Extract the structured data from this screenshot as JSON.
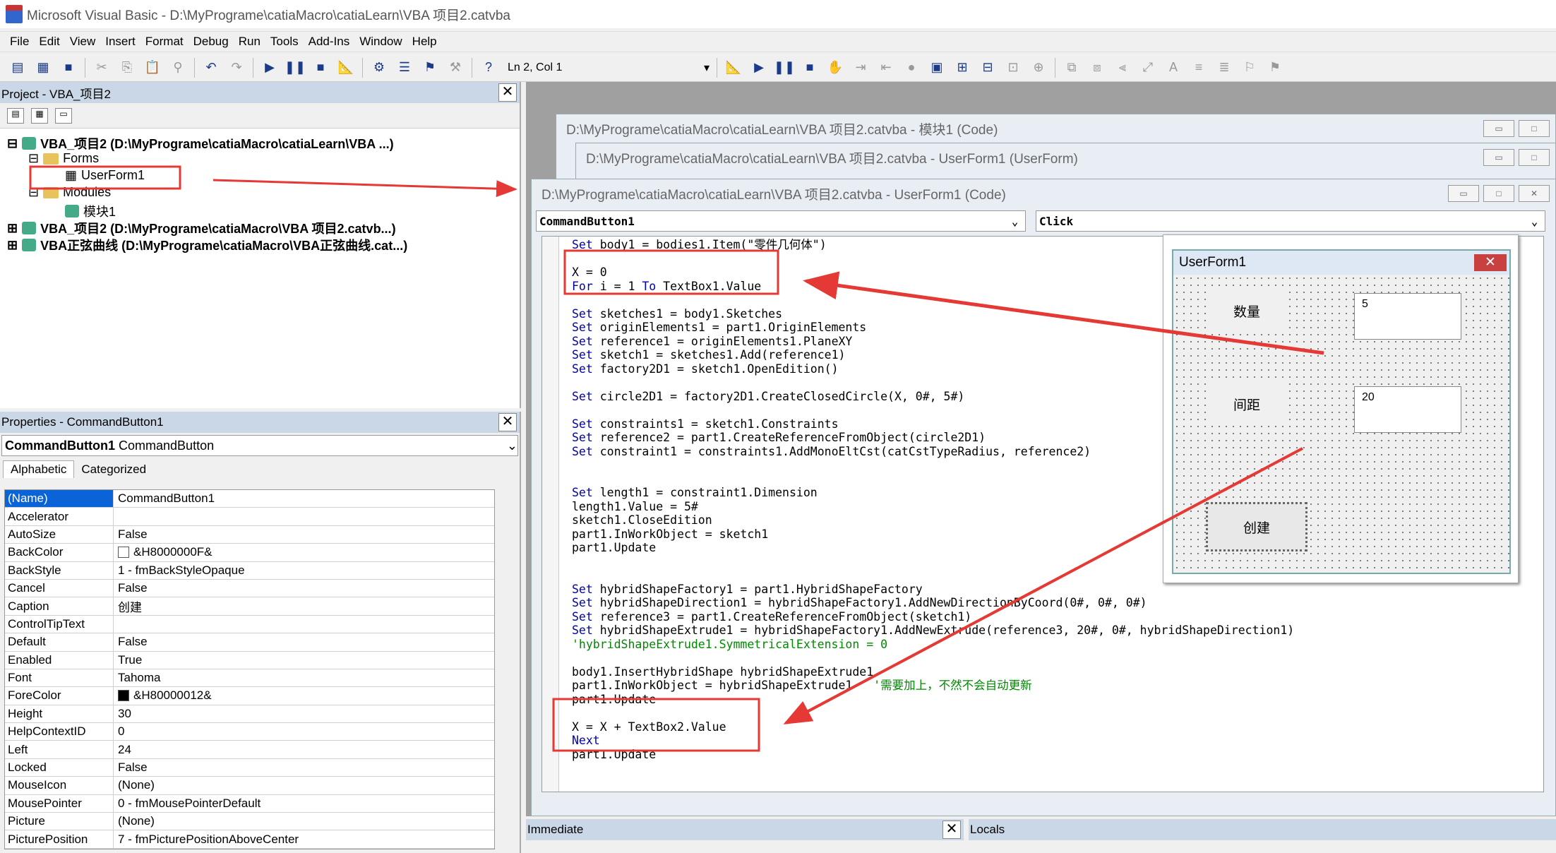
{
  "window": {
    "title": "Microsoft Visual Basic - D:\\MyPrograme\\catiaMacro\\catiaLearn\\VBA 项目2.catvba"
  },
  "menu": [
    "File",
    "Edit",
    "View",
    "Insert",
    "Format",
    "Debug",
    "Run",
    "Tools",
    "Add-Ins",
    "Window",
    "Help"
  ],
  "toolbar": {
    "position": "Ln 2, Col 1"
  },
  "project": {
    "title": "Project - VBA_项目2",
    "tree": [
      {
        "label": "VBA_项目2 (D:\\MyPrograme\\catiaMacro\\catiaLearn\\VBA ...)"
      },
      {
        "label": "Forms"
      },
      {
        "label": "UserForm1"
      },
      {
        "label": "Modules"
      },
      {
        "label": "模块1"
      },
      {
        "label": "VBA_项目2 (D:\\MyPrograme\\catiaMacro\\VBA 项目2.catvb...)"
      },
      {
        "label": "VBA正弦曲线 (D:\\MyPrograme\\catiaMacro\\VBA正弦曲线.cat...)"
      }
    ]
  },
  "properties": {
    "title": "Properties - CommandButton1",
    "object_name": "CommandButton1",
    "object_type": "CommandButton",
    "tabs": [
      "Alphabetic",
      "Categorized"
    ],
    "rows": [
      {
        "k": "(Name)",
        "v": "CommandButton1"
      },
      {
        "k": "Accelerator",
        "v": ""
      },
      {
        "k": "AutoSize",
        "v": "False"
      },
      {
        "k": "BackColor",
        "v": "&H8000000F&",
        "swatch": "#ffffff"
      },
      {
        "k": "BackStyle",
        "v": "1 - fmBackStyleOpaque"
      },
      {
        "k": "Cancel",
        "v": "False"
      },
      {
        "k": "Caption",
        "v": "创建"
      },
      {
        "k": "ControlTipText",
        "v": ""
      },
      {
        "k": "Default",
        "v": "False"
      },
      {
        "k": "Enabled",
        "v": "True"
      },
      {
        "k": "Font",
        "v": "Tahoma"
      },
      {
        "k": "ForeColor",
        "v": "&H80000012&",
        "swatch": "#000000"
      },
      {
        "k": "Height",
        "v": "30"
      },
      {
        "k": "HelpContextID",
        "v": "0"
      },
      {
        "k": "Left",
        "v": "24"
      },
      {
        "k": "Locked",
        "v": "False"
      },
      {
        "k": "MouseIcon",
        "v": "(None)"
      },
      {
        "k": "MousePointer",
        "v": "0 - fmMousePointerDefault"
      },
      {
        "k": "Picture",
        "v": "(None)"
      },
      {
        "k": "PicturePosition",
        "v": "7 - fmPicturePositionAboveCenter"
      }
    ]
  },
  "windows": {
    "module": "D:\\MyPrograme\\catiaMacro\\catiaLearn\\VBA 项目2.catvba - 模块1 (Code)",
    "form_designer": "D:\\MyPrograme\\catiaMacro\\catiaLearn\\VBA 项目2.catvba - UserForm1 (UserForm)",
    "code": "D:\\MyPrograme\\catiaMacro\\catiaLearn\\VBA 项目2.catvba - UserForm1 (Code)"
  },
  "code_window": {
    "object": "CommandButton1",
    "procedure": "Click",
    "lines": [
      "Set body1 = bodies1.Item(\"零件几何体\")",
      "",
      "X = 0",
      "For i = 1 To TextBox1.Value",
      "",
      "Set sketches1 = body1.Sketches",
      "Set originElements1 = part1.OriginElements",
      "Set reference1 = originElements1.PlaneXY",
      "Set sketch1 = sketches1.Add(reference1)",
      "Set factory2D1 = sketch1.OpenEdition()",
      "",
      "Set circle2D1 = factory2D1.CreateClosedCircle(X, 0#, 5#)",
      "",
      "Set constraints1 = sketch1.Constraints",
      "Set reference2 = part1.CreateReferenceFromObject(circle2D1)",
      "Set constraint1 = constraints1.AddMonoEltCst(catCstTypeRadius, reference2)",
      "",
      "",
      "Set length1 = constraint1.Dimension",
      "length1.Value = 5#",
      "sketch1.CloseEdition",
      "part1.InWorkObject = sketch1",
      "part1.Update",
      "",
      "",
      "Set hybridShapeFactory1 = part1.HybridShapeFactory",
      "Set hybridShapeDirection1 = hybridShapeFactory1.AddNewDirectionByCoord(0#, 0#, 0#)",
      "Set reference3 = part1.CreateReferenceFromObject(sketch1)",
      "Set hybridShapeExtrude1 = hybridShapeFactory1.AddNewExtrude(reference3, 20#, 0#, hybridShapeDirection1)",
      "'hybridShapeExtrude1.SymmetricalExtension = 0",
      "",
      "body1.InsertHybridShape hybridShapeExtrude1",
      "part1.InWorkObject = hybridShapeExtrude1   '需要加上，不然不会自动更新",
      "part1.Update",
      "",
      "X = X + TextBox2.Value",
      "Next",
      "part1.Update"
    ]
  },
  "userform": {
    "title": "UserForm1",
    "label1": "数量",
    "textbox1": "5",
    "label2": "间距",
    "textbox2": "20",
    "button": "创建"
  },
  "bottom": {
    "immediate": "Immediate",
    "locals": "Locals"
  },
  "colors": {
    "keyword": "#0000aa",
    "comment": "#008000",
    "annotation": "#e53935",
    "selection": "#0a64d8"
  }
}
